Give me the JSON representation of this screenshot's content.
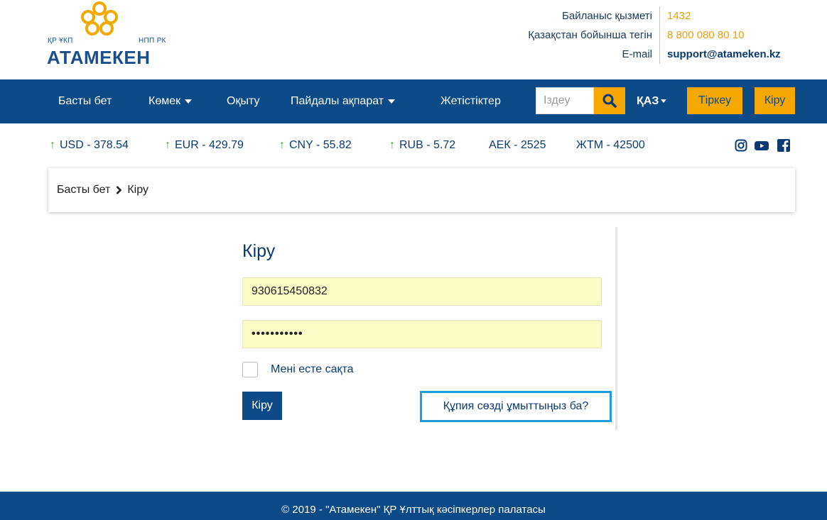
{
  "header": {
    "logo": {
      "sub_left": "ҚР ҰКП",
      "sub_right": "НПП РК",
      "brand": "АТАМЕКЕН"
    },
    "contacts": [
      {
        "label": "Байланыс қызметі",
        "value": "1432"
      },
      {
        "label": "Қазақстан бойынша тегін",
        "value": "8 800 080 80 10"
      },
      {
        "label": "E-mail",
        "value": "support@atameken.kz"
      }
    ]
  },
  "nav": {
    "items": [
      {
        "label": "Басты бет"
      },
      {
        "label": "Көмек"
      },
      {
        "label": "Оқыту"
      },
      {
        "label": "Пайдалы ақпарат"
      },
      {
        "label": "Жетістіктер"
      }
    ],
    "search_placeholder": "Іздеу",
    "lang": "ҚАЗ",
    "register": "Тіркеу",
    "login": "Кіру"
  },
  "currency": [
    {
      "label": "USD - 378.54",
      "up": true
    },
    {
      "label": "EUR - 429.79",
      "up": true
    },
    {
      "label": "CNY - 55.82",
      "up": true
    },
    {
      "label": "RUB - 5.72",
      "up": true
    },
    {
      "label": "АЕК - 2525",
      "up": false
    },
    {
      "label": "ЖТМ - 42500",
      "up": false
    }
  ],
  "social": [
    "instagram-icon",
    "youtube-icon",
    "facebook-icon"
  ],
  "breadcrumb": {
    "home": "Басты бет",
    "current": "Кіру"
  },
  "login": {
    "title": "Кіру",
    "username_value": "930615450832",
    "password_value": "•••••••••••",
    "remember_label": "Мені есте сақта",
    "submit_label": "Кіру",
    "forgot_label": "Құпия сөзді ұмыттыңыз ба?"
  },
  "footer": {
    "text": "© 2019 - \"Атамекен\" ҚР Ұлттық кәсіпкерлер палатасы"
  },
  "colors": {
    "primary": "#0b4a86",
    "accent": "#f6a800",
    "field_bg": "#fbfdc7",
    "focus": "#1e9be0",
    "up_arrow": "#3aaa35"
  }
}
